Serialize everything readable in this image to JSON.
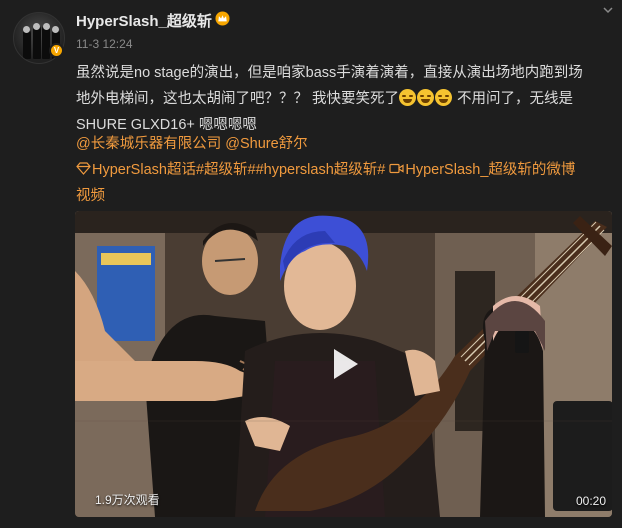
{
  "post": {
    "username": "HyperSlash_超级斩",
    "timestamp": "11-3 12:24",
    "text_line1": "虽然说是no stage的演出，但是咱家bass手演着演着，直接从演出场地内跑到场",
    "text_line2_a": "地外电梯间，这也太胡闹了吧？？？ 我快要笑死了",
    "text_line2_b": " 不用问了，无线是",
    "text_line3": "SHURE GLXD16+ 嗯嗯嗯嗯",
    "mention1": "@长秦城乐器有限公司",
    "mention2": "@Shure舒尔",
    "topic1": "HyperSlash超话",
    "topic2": "#超级斩#",
    "topic3": "#hyperslash超级斩#",
    "video_link_a": "HyperSlash_超级斩的微博",
    "video_link_b": "视频"
  },
  "video": {
    "views": "1.9万次观看",
    "duration": "00:20"
  },
  "icons": {
    "verified": "v-badge-icon",
    "crown": "crown-icon",
    "chevron": "chevron-down-icon",
    "supertopic": "diamond-icon",
    "video_link": "video-camera-icon",
    "emoji": "laughing-emoji-icon",
    "play": "play-icon"
  },
  "colors": {
    "background": "#1e1e1e",
    "link": "#f09a3e",
    "verified_badge": "#f7a600",
    "hair": "#3d4fd6"
  }
}
